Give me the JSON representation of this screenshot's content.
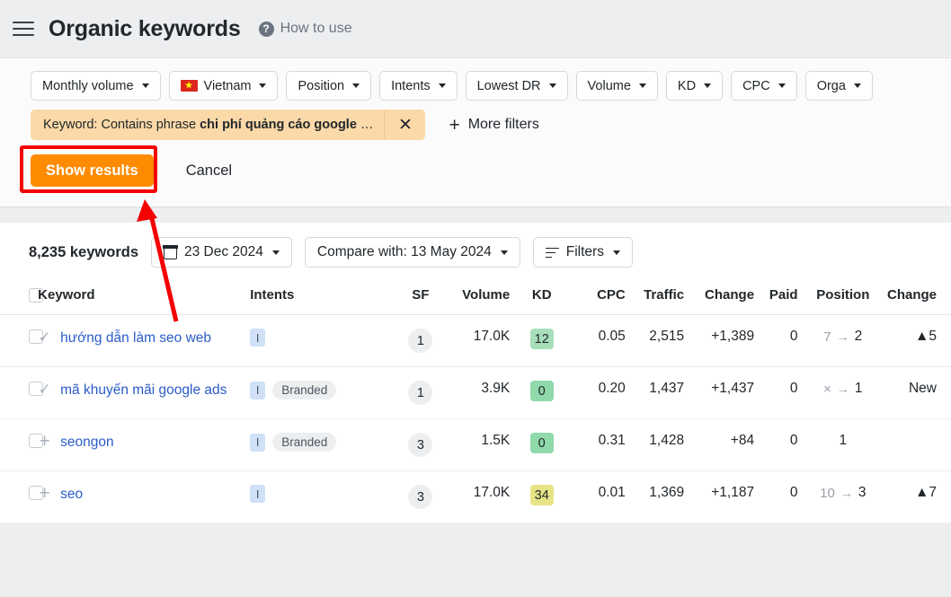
{
  "header": {
    "menu_icon": "hamburger-icon",
    "title": "Organic keywords",
    "help_icon": "question-mark-icon",
    "help_label": "How to use"
  },
  "filters": {
    "buttons": [
      {
        "label": "Monthly volume",
        "icon": "chevron-down-icon"
      },
      {
        "label": "Vietnam",
        "icon": "chevron-down-icon",
        "flag": "vietnam-flag"
      },
      {
        "label": "Position",
        "icon": "chevron-down-icon"
      },
      {
        "label": "Intents",
        "icon": "chevron-down-icon"
      },
      {
        "label": "Lowest DR",
        "icon": "chevron-down-icon"
      },
      {
        "label": "Volume",
        "icon": "chevron-down-icon"
      },
      {
        "label": "KD",
        "icon": "chevron-down-icon"
      },
      {
        "label": "CPC",
        "icon": "chevron-down-icon"
      },
      {
        "label": "Orga",
        "icon": "chevron-down-icon"
      }
    ],
    "chip": {
      "prefix": "Keyword: Contains phrase ",
      "value": "chi phí quảng cáo google",
      "suffix": " …",
      "close_icon": "close-icon"
    },
    "more_filters": {
      "icon": "plus-icon",
      "label": "More filters"
    },
    "show_results_label": "Show results",
    "cancel_label": "Cancel",
    "highlight_color": "#f50000",
    "accent_color": "#ff8b00"
  },
  "results": {
    "keyword_count": "8,235 keywords",
    "date_button": {
      "icon": "calendar-icon",
      "label": "23 Dec 2024",
      "caret": "chevron-down-icon"
    },
    "compare_button": {
      "label": "Compare with: 13 May 2024",
      "caret": "chevron-down-icon"
    },
    "filters_button": {
      "icon": "filters-icon",
      "label": "Filters",
      "caret": "chevron-down-icon"
    },
    "columns": [
      "Keyword",
      "Intents",
      "SF",
      "Volume",
      "KD",
      "CPC",
      "Traffic",
      "Change",
      "Paid",
      "Position",
      "Change"
    ],
    "rows": [
      {
        "mark": "check",
        "keyword": "hướng dẫn làm seo web",
        "intent": "I",
        "tag": "",
        "sf": "1",
        "volume": "17.0K",
        "kd": "12",
        "kd_color": "#a8dfbb",
        "cpc": "0.05",
        "traffic": "2,515",
        "change": "+1,389",
        "paid": "0",
        "pos_old": "7",
        "pos_new": "2",
        "pos_change": "▲5"
      },
      {
        "mark": "check",
        "keyword": "mã khuyến mãi google ads",
        "intent": "I",
        "tag": "Branded",
        "sf": "1",
        "volume": "3.9K",
        "kd": "0",
        "kd_color": "#8fd9ab",
        "cpc": "0.20",
        "traffic": "1,437",
        "change": "+1,437",
        "paid": "0",
        "pos_old": "×",
        "pos_new": "1",
        "pos_change": "New"
      },
      {
        "mark": "plus",
        "keyword": "seongon",
        "intent": "I",
        "tag": "Branded",
        "sf": "3",
        "volume": "1.5K",
        "kd": "0",
        "kd_color": "#8fd9ab",
        "cpc": "0.31",
        "traffic": "1,428",
        "change": "+84",
        "paid": "0",
        "pos_old": "",
        "pos_new": "1",
        "pos_change": ""
      },
      {
        "mark": "plus",
        "keyword": "seo",
        "intent": "I",
        "tag": "",
        "sf": "3",
        "volume": "17.0K",
        "kd": "34",
        "kd_color": "#e7e486",
        "cpc": "0.01",
        "traffic": "1,369",
        "change": "+1,187",
        "paid": "0",
        "pos_old": "10",
        "pos_new": "3",
        "pos_change": "▲7"
      }
    ]
  }
}
